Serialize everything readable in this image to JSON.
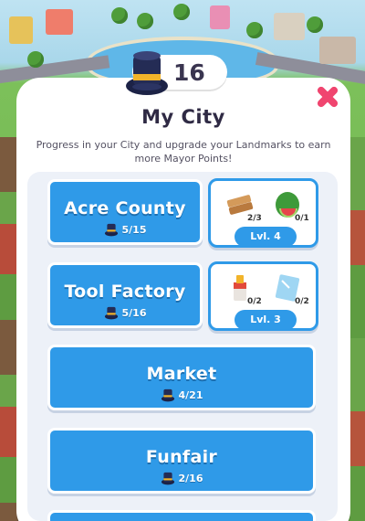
{
  "mayor_points": {
    "value": "16"
  },
  "dialog": {
    "title": "My City",
    "subtitle": "Progress in your City and upgrade your Landmarks to earn more Mayor Points!"
  },
  "landmarks": [
    {
      "name": "Acre County",
      "progress": "5/15",
      "level": "Lvl. 4",
      "resources": [
        {
          "icon": "wood-planks-icon",
          "count": "2/3"
        },
        {
          "icon": "watermelon-icon",
          "count": "0/1"
        }
      ]
    },
    {
      "name": "Tool Factory",
      "progress": "5/16",
      "level": "Lvl. 3",
      "resources": [
        {
          "icon": "paint-bucket-icon",
          "count": "0/2"
        },
        {
          "icon": "glass-pane-icon",
          "count": "0/2"
        }
      ]
    },
    {
      "name": "Market",
      "progress": "4/21"
    },
    {
      "name": "Funfair",
      "progress": "2/16"
    }
  ],
  "colors": {
    "card_blue": "#2f9ae8",
    "close_pink": "#f0456f",
    "hat_navy": "#242c55",
    "hat_band": "#f2b42a"
  }
}
